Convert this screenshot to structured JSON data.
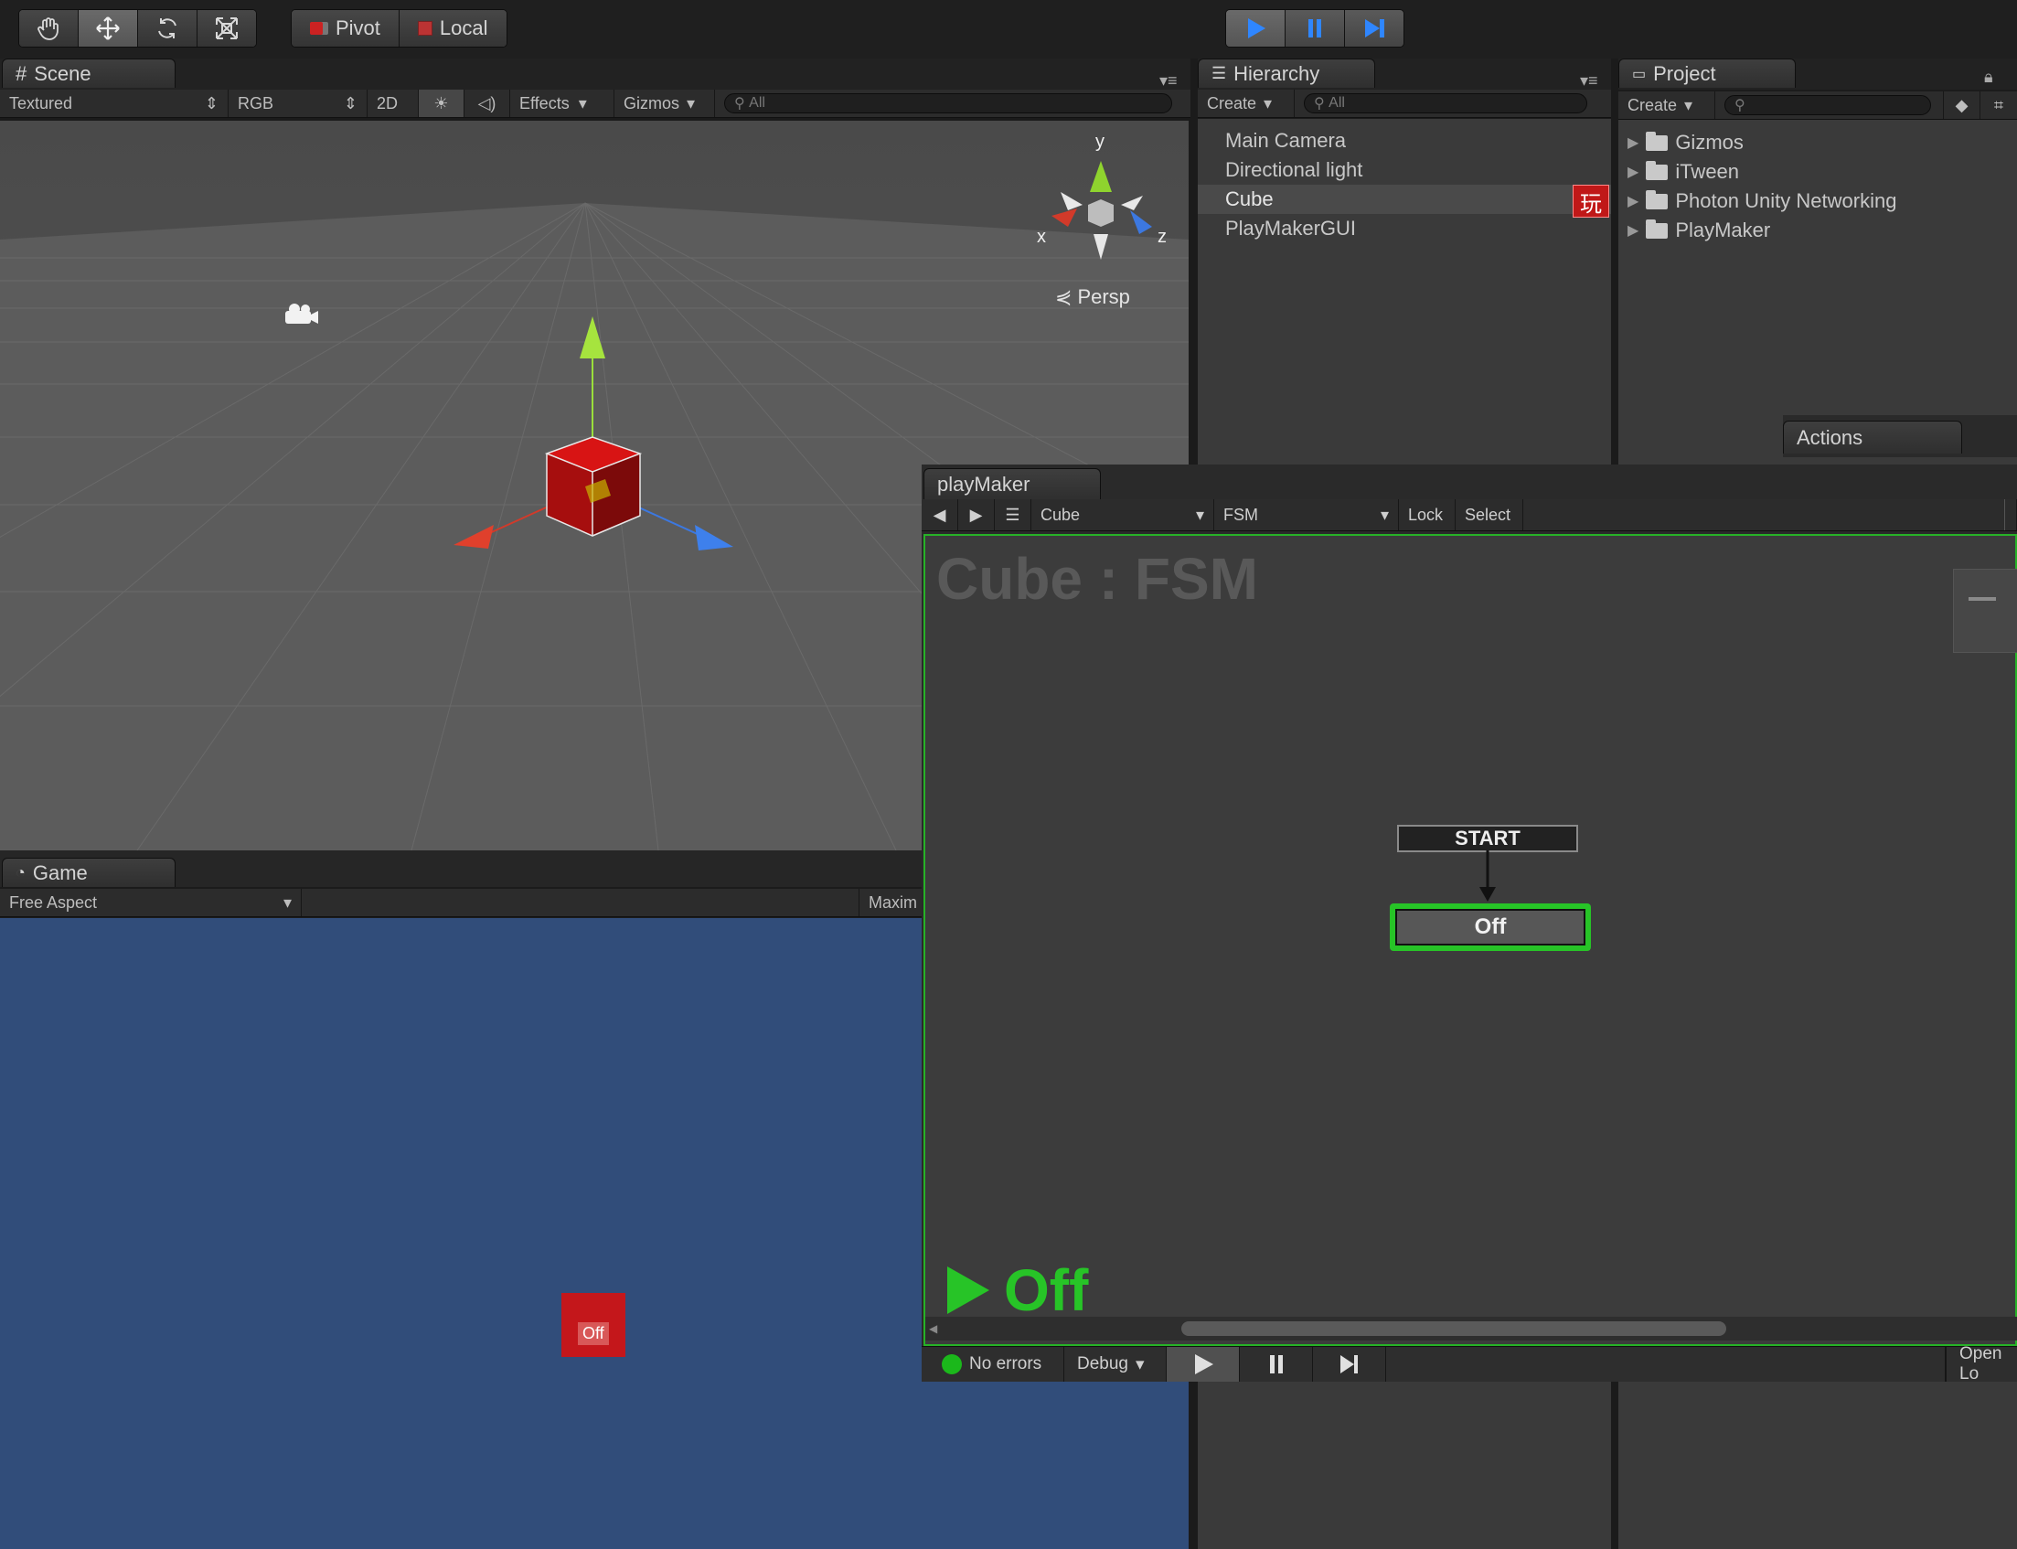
{
  "toolbar": {
    "pivot_label": "Pivot",
    "local_label": "Local",
    "play_color": "#2f86ff"
  },
  "scene": {
    "tab": "Scene",
    "shading": "Textured",
    "channel": "RGB",
    "mode_2d": "2D",
    "effects": "Effects",
    "gizmos": "Gizmos",
    "search_placeholder": "All",
    "axis_x": "x",
    "axis_y": "y",
    "axis_z": "z",
    "projection": "Persp"
  },
  "game": {
    "tab": "Game",
    "aspect": "Free Aspect",
    "maximize": "Maxim",
    "cube_label": "Off"
  },
  "hierarchy": {
    "tab": "Hierarchy",
    "create": "Create",
    "search_placeholder": "All",
    "items": [
      "Main Camera",
      "Directional light",
      "Cube",
      "PlayMakerGUI"
    ],
    "badge": "玩"
  },
  "project": {
    "tab": "Project",
    "create": "Create",
    "folders": [
      "Gizmos",
      "iTween",
      "Photon Unity Networking",
      "PlayMaker"
    ]
  },
  "actions": {
    "tab": "Actions"
  },
  "playmaker": {
    "tab": "playMaker",
    "object": "Cube",
    "fsm": "FSM",
    "lock": "Lock",
    "select": "Select",
    "title": "Cube : FSM",
    "start_node": "START",
    "state_node": "Off",
    "active_state": "Off",
    "status_errors": "No errors",
    "debug": "Debug",
    "open_log": "Open Lo",
    "accent": "#27c427"
  }
}
